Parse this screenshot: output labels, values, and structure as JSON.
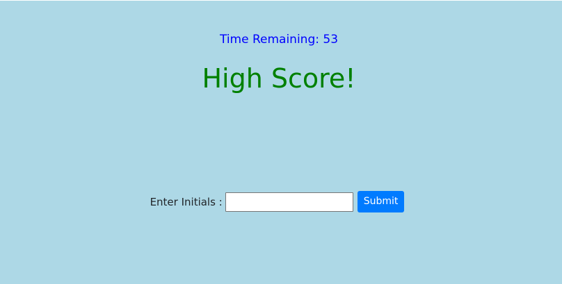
{
  "game": {
    "timer_label": "Time Remaining: 53",
    "title": "High Score!"
  },
  "form": {
    "initials_label": "Enter Initials :",
    "initials_value": "",
    "submit_label": "Submit"
  },
  "colors": {
    "background": "#add8e6",
    "timer": "#0000ff",
    "title": "#008000",
    "button": "#007bff"
  }
}
